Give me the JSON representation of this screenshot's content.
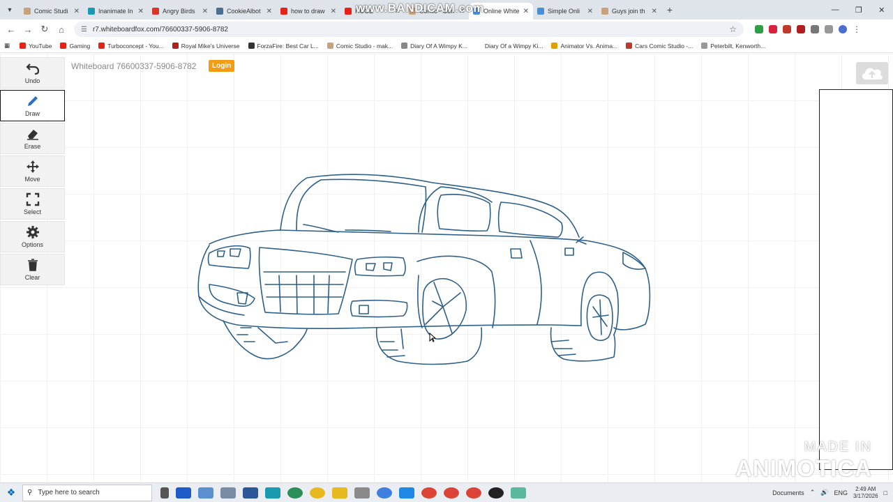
{
  "browser": {
    "tabs": [
      {
        "label": "Comic Studi",
        "color": "#c7a27c"
      },
      {
        "label": "Inanimate In",
        "color": "#1a9ab0"
      },
      {
        "label": "Angry Birds",
        "color": "#d9342b"
      },
      {
        "label": "CookieAlbot",
        "color": "#4a6e8f"
      },
      {
        "label": "how to draw",
        "color": "#e62117"
      },
      {
        "label": "HUGE",
        "color": "#e62117"
      },
      {
        "label": "Comic - Con",
        "color": "#c7a27c"
      },
      {
        "label": "Online White",
        "color": "#4a8fd6",
        "active": true
      },
      {
        "label": "Simple Onli",
        "color": "#4a8fd6"
      },
      {
        "label": "Guys join th",
        "color": "#c7a27c"
      }
    ],
    "watermark_top": "www.BANDICAM.com",
    "url": "r7.whiteboardfox.com/76600337-5906-8782",
    "bookmarks": [
      {
        "label": "YouTube",
        "color": "#e62117"
      },
      {
        "label": "Gaming",
        "color": "#e62117"
      },
      {
        "label": "Turboconcept - You...",
        "color": "#e62117"
      },
      {
        "label": "Royal Mike's Universe",
        "color": "#b01e1e"
      },
      {
        "label": "ForzaFire: Best Car L...",
        "color": "#333333"
      },
      {
        "label": "Comic Studio - mak...",
        "color": "#c7a27c"
      },
      {
        "label": "Diary Of A Wimpy K...",
        "color": "#888888"
      },
      {
        "label": "Diary Of a Wimpy Ki...",
        "color": "#ffffff"
      },
      {
        "label": "Animator Vs. Anima...",
        "color": "#e0a000"
      },
      {
        "label": "Cars Comic Studio -...",
        "color": "#c0392b"
      },
      {
        "label": "Peterbilt, Kenworth...",
        "color": "#999999"
      }
    ]
  },
  "toolbar": {
    "undo": "Undo",
    "draw": "Draw",
    "erase": "Erase",
    "move": "Move",
    "select": "Select",
    "options": "Options",
    "clear": "Clear"
  },
  "board": {
    "title": "Whiteboard 76600337-5906-8782",
    "login_label": "Login",
    "stroke_color": "#2c5f8a"
  },
  "watermark_bottom": {
    "line1": "MADE IN",
    "line2": "ANIMOTICA"
  },
  "taskbar": {
    "search_placeholder": "Type here to search",
    "documents": "Documents",
    "language": "ENG",
    "time": "2:49 AM",
    "date": "3/17/2026"
  }
}
